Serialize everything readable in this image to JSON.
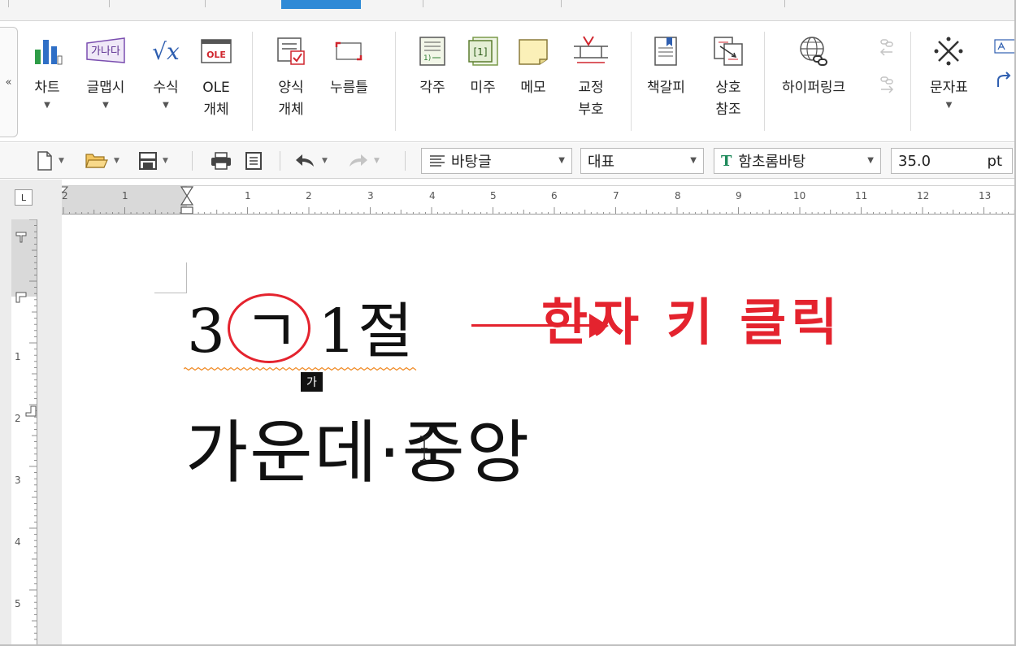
{
  "ribbon": {
    "collapse_label": "«",
    "buttons": [
      {
        "label": "차트",
        "icon": "bar-chart-icon"
      },
      {
        "label": "글맵시",
        "icon": "word-art-icon",
        "icon_text": "가나다"
      },
      {
        "label": "수식",
        "icon": "equation-icon",
        "icon_text": "√x"
      },
      {
        "label": "OLE\n개체",
        "icon": "ole-object-icon",
        "icon_text": "OLE"
      },
      {
        "label": "양식\n개체",
        "icon": "form-object-icon"
      },
      {
        "label": "누름틀",
        "icon": "click-field-icon"
      },
      {
        "label": "각주",
        "icon": "footnote-icon",
        "icon_text": "1)"
      },
      {
        "label": "미주",
        "icon": "endnote-icon",
        "icon_text": "[1]"
      },
      {
        "label": "메모",
        "icon": "memo-icon"
      },
      {
        "label": "교정\n부호",
        "icon": "proofreading-mark-icon"
      },
      {
        "label": "책갈피",
        "icon": "bookmark-icon"
      },
      {
        "label": "상호\n참조",
        "icon": "cross-reference-icon"
      },
      {
        "label": "하이퍼링크",
        "icon": "hyperlink-icon"
      },
      {
        "label": "문자표",
        "icon": "symbol-table-icon"
      }
    ]
  },
  "toolbar": {
    "style": "바탕글",
    "language": "대표",
    "font": "함초롬바탕",
    "font_icon_text": "T",
    "size": "35.0",
    "size_unit": "pt"
  },
  "ruler": {
    "h_numbers": [
      "2",
      "1",
      "1",
      "2",
      "3",
      "4",
      "5",
      "6",
      "7",
      "8",
      "9",
      "10",
      "11",
      "12",
      "13"
    ],
    "v_numbers": [
      "1",
      "2",
      "3",
      "4",
      "5"
    ],
    "corner_label": "L"
  },
  "document": {
    "line1_pre": "3",
    "line1_char": "ㄱ",
    "line1_post": "1절",
    "ime_badge": "가",
    "annotation": "한자 키 클릭",
    "line2": "가운데·중앙"
  },
  "colors": {
    "annotation_red": "#e4232e",
    "active_tab_blue": "#2f8ad6",
    "squiggle_orange": "#f08a24"
  }
}
